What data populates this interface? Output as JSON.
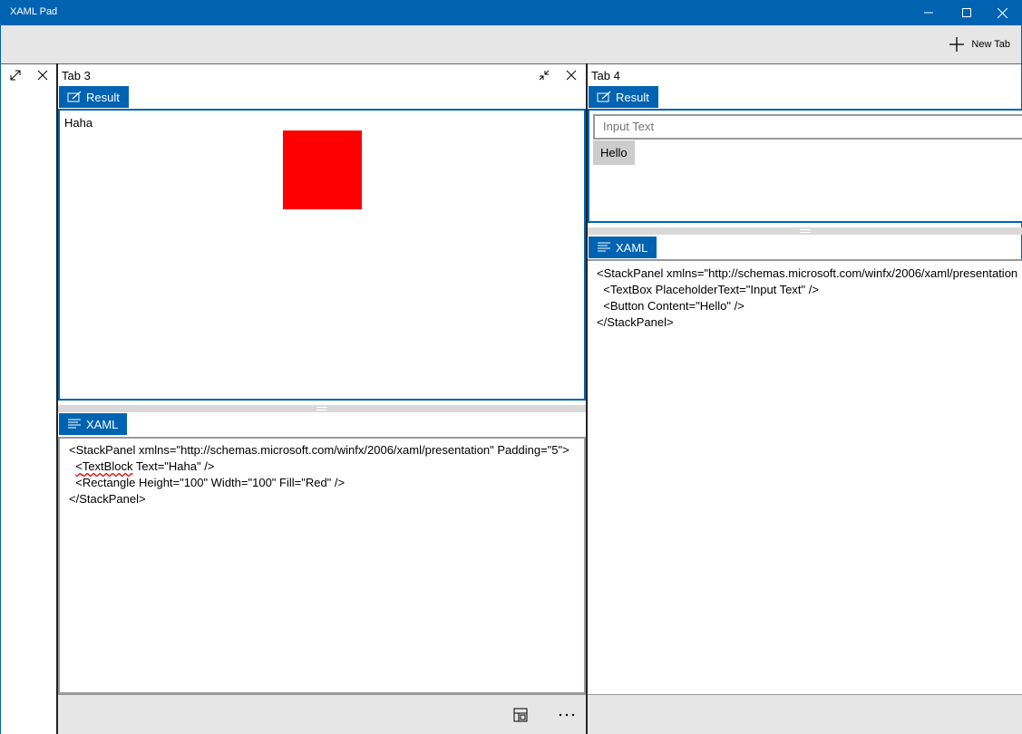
{
  "window": {
    "title": "XAML Pad",
    "accent": "#0063b1"
  },
  "toolbar": {
    "new_tab_label": "New Tab"
  },
  "left_strip": {
    "icons": [
      "expand-icon",
      "close-icon"
    ]
  },
  "tab3": {
    "title": "Tab 3",
    "result_tab_label": "Result",
    "result_text": "Haha",
    "rectangle_fill": "#ff0000",
    "xaml_tab_label": "XAML",
    "xaml_lines": [
      "<StackPanel xmlns=\"http://schemas.microsoft.com/winfx/2006/xaml/presentation\" Padding=\"5\">",
      "  <TextBlock Text=\"Haha\" />",
      "  <Rectangle Height=\"100\" Width=\"100\" Fill=\"Red\" />",
      "</StackPanel>"
    ],
    "squiggle_word": "TextBlock",
    "bottom_icons": [
      "layout-icon",
      "more-icon"
    ]
  },
  "tab4": {
    "title": "Tab 4",
    "result_tab_label": "Result",
    "input_placeholder": "Input Text",
    "button_label": "Hello",
    "xaml_tab_label": "XAML",
    "xaml_lines": [
      "<StackPanel xmlns=\"http://schemas.microsoft.com/winfx/2006/xaml/presentation",
      "  <TextBox PlaceholderText=\"Input Text\" />",
      "  <Button Content=\"Hello\" />",
      "</StackPanel>"
    ]
  }
}
